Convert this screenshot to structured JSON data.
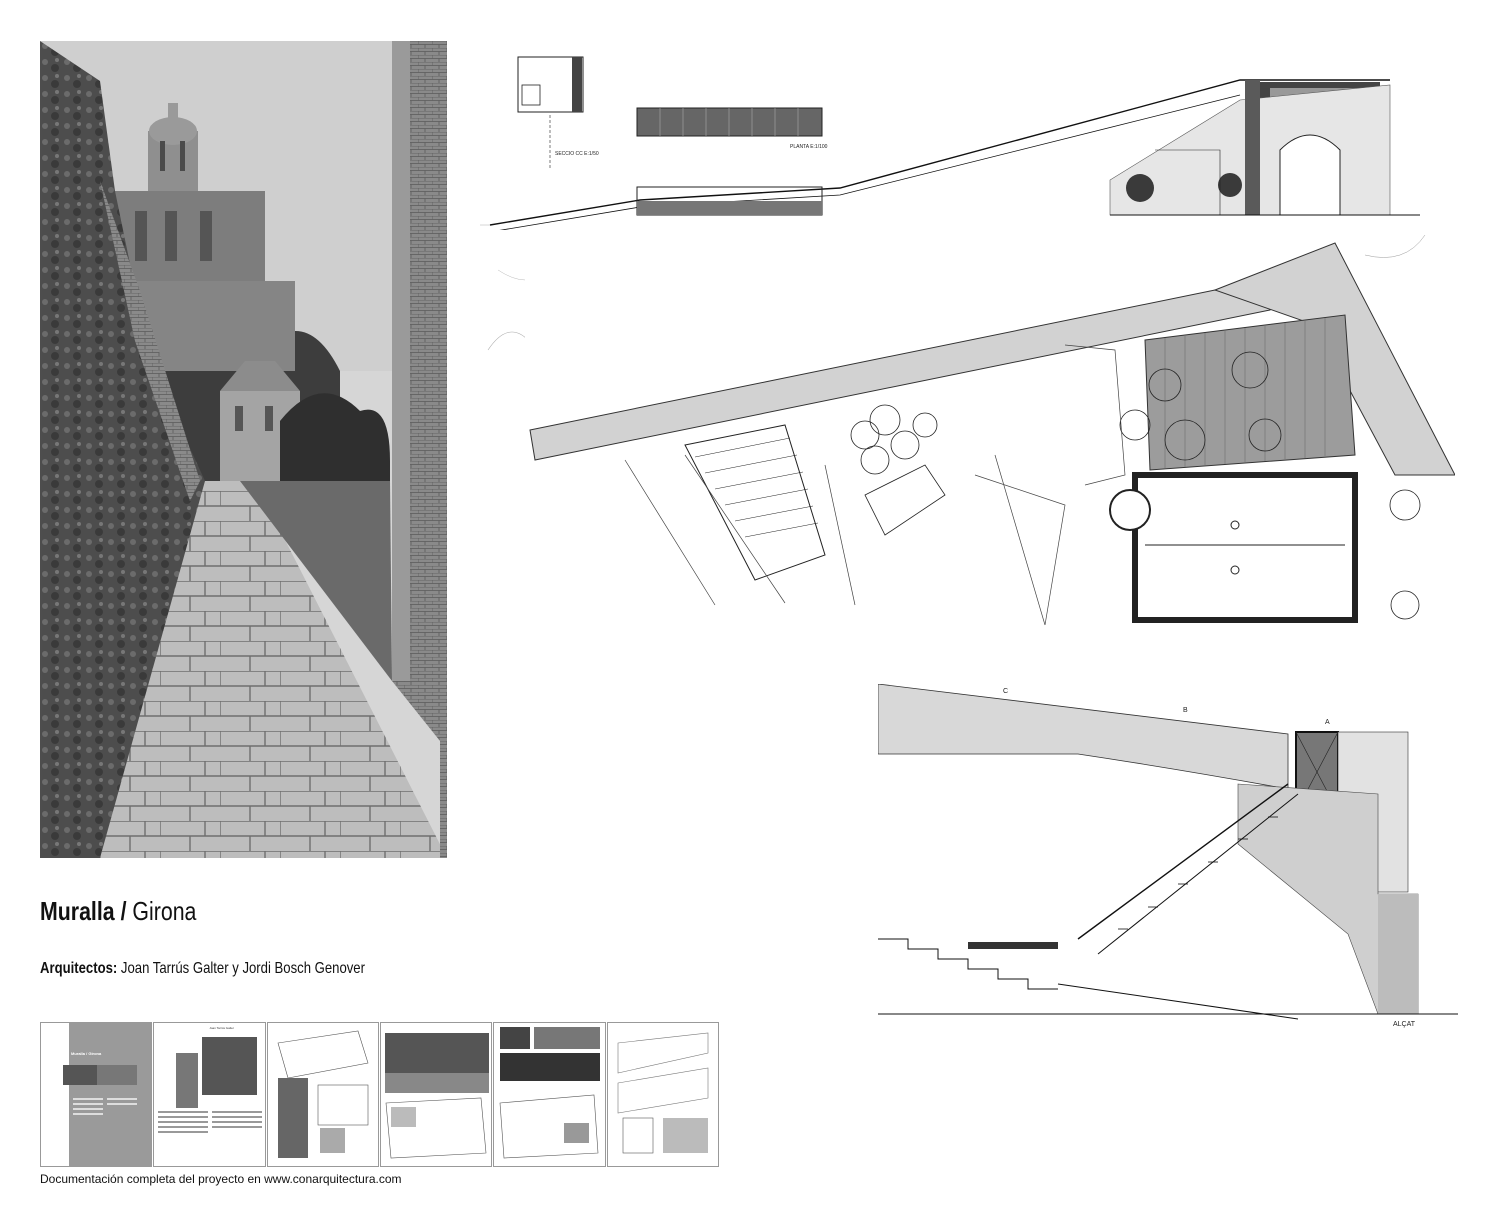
{
  "title": {
    "bold": "Muralla /",
    "regular": " Girona"
  },
  "architects": {
    "label": "Arquitectos:",
    "names": " Joan Tarrús Galter y Jordi Bosch Genover"
  },
  "footer": "Documentación completa del proyecto en www.conarquitectura.com",
  "drawings": {
    "top_section": {
      "planta": "PLANTA E:1/100",
      "seccio": "SECCIO CC E:1/50"
    },
    "elevation": {
      "label": "ALÇAT",
      "mark_c": "C",
      "mark_b": "B",
      "mark_a": "A"
    }
  },
  "thumbnails": [
    {
      "heading": "Muralla / Girona"
    },
    {
      "heading": "Joan Tarrús Galter"
    },
    {
      "heading": ""
    },
    {
      "heading": ""
    },
    {
      "heading": ""
    },
    {
      "heading": ""
    }
  ]
}
